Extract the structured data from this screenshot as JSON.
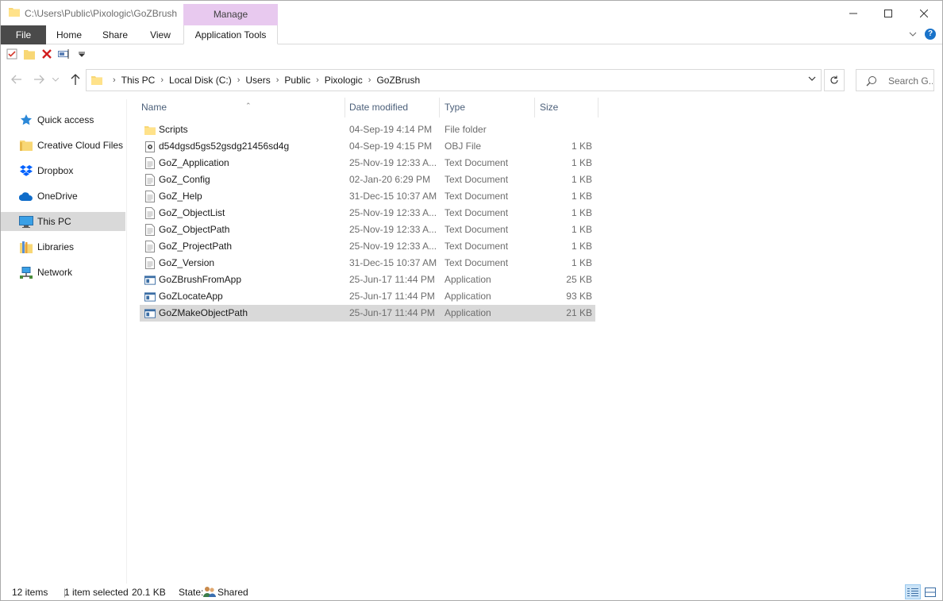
{
  "window": {
    "title": "C:\\Users\\Public\\Pixologic\\GoZBrush",
    "context_tab_group": "Manage"
  },
  "ribbon": {
    "tabs": [
      "File",
      "Home",
      "Share",
      "View",
      "Application Tools"
    ]
  },
  "address": {
    "breadcrumbs": [
      "This PC",
      "Local Disk (C:)",
      "Users",
      "Public",
      "Pixologic",
      "GoZBrush"
    ]
  },
  "search": {
    "placeholder": "Search G..."
  },
  "navpane": {
    "items": [
      {
        "label": "Quick access",
        "icon": "star-icon"
      },
      {
        "label": "Creative Cloud Files",
        "icon": "cloud-folder-icon"
      },
      {
        "label": "Dropbox",
        "icon": "dropbox-icon"
      },
      {
        "label": "OneDrive",
        "icon": "onedrive-icon"
      },
      {
        "label": "This PC",
        "icon": "computer-icon",
        "selected": true
      },
      {
        "label": "Libraries",
        "icon": "libraries-icon"
      },
      {
        "label": "Network",
        "icon": "network-icon"
      }
    ]
  },
  "columns": {
    "name": "Name",
    "date": "Date modified",
    "type": "Type",
    "size": "Size"
  },
  "files": [
    {
      "name": "Scripts",
      "date": "04-Sep-19 4:14 PM",
      "type": "File folder",
      "size": "",
      "icon": "folder-icon"
    },
    {
      "name": "d54dgsd5gs52gsdg21456sd4g",
      "date": "04-Sep-19 4:15 PM",
      "type": "OBJ File",
      "size": "1 KB",
      "icon": "obj-file-icon"
    },
    {
      "name": "GoZ_Application",
      "date": "25-Nov-19 12:33 A...",
      "type": "Text Document",
      "size": "1 KB",
      "icon": "text-file-icon"
    },
    {
      "name": "GoZ_Config",
      "date": "02-Jan-20 6:29 PM",
      "type": "Text Document",
      "size": "1 KB",
      "icon": "text-file-icon"
    },
    {
      "name": "GoZ_Help",
      "date": "31-Dec-15 10:37 AM",
      "type": "Text Document",
      "size": "1 KB",
      "icon": "text-file-icon"
    },
    {
      "name": "GoZ_ObjectList",
      "date": "25-Nov-19 12:33 A...",
      "type": "Text Document",
      "size": "1 KB",
      "icon": "text-file-icon"
    },
    {
      "name": "GoZ_ObjectPath",
      "date": "25-Nov-19 12:33 A...",
      "type": "Text Document",
      "size": "1 KB",
      "icon": "text-file-icon"
    },
    {
      "name": "GoZ_ProjectPath",
      "date": "25-Nov-19 12:33 A...",
      "type": "Text Document",
      "size": "1 KB",
      "icon": "text-file-icon"
    },
    {
      "name": "GoZ_Version",
      "date": "31-Dec-15 10:37 AM",
      "type": "Text Document",
      "size": "1 KB",
      "icon": "text-file-icon"
    },
    {
      "name": "GoZBrushFromApp",
      "date": "25-Jun-17 11:44 PM",
      "type": "Application",
      "size": "25 KB",
      "icon": "application-icon"
    },
    {
      "name": "GoZLocateApp",
      "date": "25-Jun-17 11:44 PM",
      "type": "Application",
      "size": "93 KB",
      "icon": "application-icon"
    },
    {
      "name": "GoZMakeObjectPath",
      "date": "25-Jun-17 11:44 PM",
      "type": "Application",
      "size": "21 KB",
      "icon": "application-icon",
      "selected": true
    }
  ],
  "status": {
    "count": "12 items",
    "selection": "1 item selected",
    "selection_size": "20.1 KB",
    "state_label": "State:",
    "state_value": "Shared"
  },
  "colors": {
    "manage_tab": "#e8c9ef",
    "file_tab": "#4a4a4a",
    "selected_row": "#d9d9d9",
    "column_header": "#4c607a"
  }
}
